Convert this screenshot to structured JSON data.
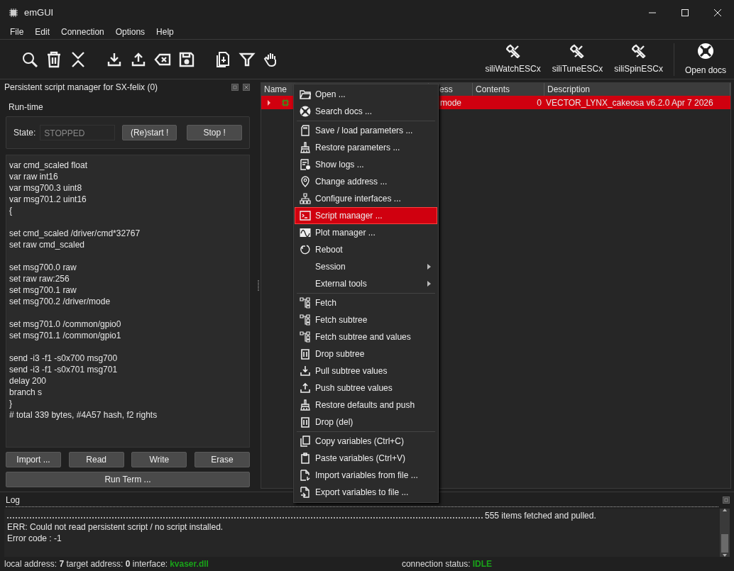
{
  "window": {
    "title": "emGUI"
  },
  "menu_bar": [
    {
      "label": "File"
    },
    {
      "label": "Edit"
    },
    {
      "label": "Connection"
    },
    {
      "label": "Options"
    },
    {
      "label": "Help"
    }
  ],
  "tool_buttons": [
    {
      "label": "siliWatchESCx"
    },
    {
      "label": "siliTuneESCx"
    },
    {
      "label": "siliSpinESCx"
    },
    {
      "label": "Open docs"
    }
  ],
  "script_panel": {
    "title": "Persistent script manager for SX-felix (0)",
    "group": "Run-time",
    "state_label": "State:",
    "state": "STOPPED",
    "run_buttons": [
      "(Re)start !",
      "Stop !"
    ],
    "script": "var cmd_scaled float\nvar raw int16\nvar msg700.3 uint8\nvar msg701.2 uint16\n{\n\nset cmd_scaled /driver/cmd*32767\nset raw cmd_scaled\n\nset msg700.0 raw\nset raw raw:256\nset msg700.1 raw\nset msg700.2 /driver/mode\n\nset msg701.0 /common/gpio0\nset msg701.1 /common/gpio1\n\nsend -i3 -f1 -s0x700 msg700\nsend -i3 -f1 -s0x701 msg701\ndelay 200\nbranch s\n}\n# total 339 bytes, #4A57 hash, f2 rights",
    "buttons": [
      "Import ...",
      "Read",
      "Write",
      "Erase"
    ],
    "run_term": "Run Term ..."
  },
  "tree": {
    "columns": [
      "Name",
      "ess",
      "Contents",
      "Description"
    ],
    "rows": [
      {
        "address": "mode",
        "contents": "0",
        "description": "VECTOR_LYNX_cakeosa v6.2.0 Apr  7 2026",
        "selected": true,
        "expanded": false
      }
    ]
  },
  "context_menu": {
    "groups": [
      [
        {
          "label": "Open ...",
          "selected": false,
          "submenu": false
        },
        {
          "label": "Search docs ...",
          "selected": false,
          "submenu": false
        }
      ],
      [
        {
          "label": "Save / load parameters ...",
          "selected": false,
          "submenu": false
        },
        {
          "label": "Restore parameters ...",
          "selected": false,
          "submenu": false
        },
        {
          "label": "Show logs ...",
          "selected": false,
          "submenu": false
        },
        {
          "label": "Change address ...",
          "selected": false,
          "submenu": false
        },
        {
          "label": "Configure interfaces ...",
          "selected": false,
          "submenu": false
        },
        {
          "label": "Script manager ...",
          "selected": true,
          "submenu": false
        },
        {
          "label": "Plot manager ...",
          "selected": false,
          "submenu": false
        },
        {
          "label": "Reboot",
          "selected": false,
          "submenu": false
        },
        {
          "label": "Session",
          "selected": false,
          "submenu": true
        },
        {
          "label": "External tools",
          "selected": false,
          "submenu": true
        }
      ],
      [
        {
          "label": "Fetch",
          "selected": false,
          "submenu": false
        },
        {
          "label": "Fetch subtree",
          "selected": false,
          "submenu": false
        },
        {
          "label": "Fetch subtree and values",
          "selected": false,
          "submenu": false
        },
        {
          "label": "Drop subtree",
          "selected": false,
          "submenu": false
        },
        {
          "label": "Pull subtree values",
          "selected": false,
          "submenu": false
        },
        {
          "label": "Push subtree values",
          "selected": false,
          "submenu": false
        },
        {
          "label": "Restore defaults and push",
          "selected": false,
          "submenu": false
        },
        {
          "label": "Drop (del)",
          "selected": false,
          "submenu": false
        }
      ],
      [
        {
          "label": "Copy variables (Ctrl+C)",
          "selected": false,
          "submenu": false
        },
        {
          "label": "Paste variables (Ctrl+V)",
          "selected": false,
          "submenu": false
        },
        {
          "label": "Import variables from file ...",
          "selected": false,
          "submenu": false
        },
        {
          "label": "Export variables to file ...",
          "selected": false,
          "submenu": false
        }
      ]
    ]
  },
  "log": {
    "title": "Log",
    "progress": "555 items fetched and pulled.",
    "lines": [
      "ERR: Could not read persistent script / no script installed.",
      "Error code : -1"
    ]
  },
  "status_bar": {
    "addresses": "local address: **7** target address: **0** interface:",
    "interface": "kvaser.dll",
    "connection_label": "connection status:",
    "connection": "IDLE"
  }
}
